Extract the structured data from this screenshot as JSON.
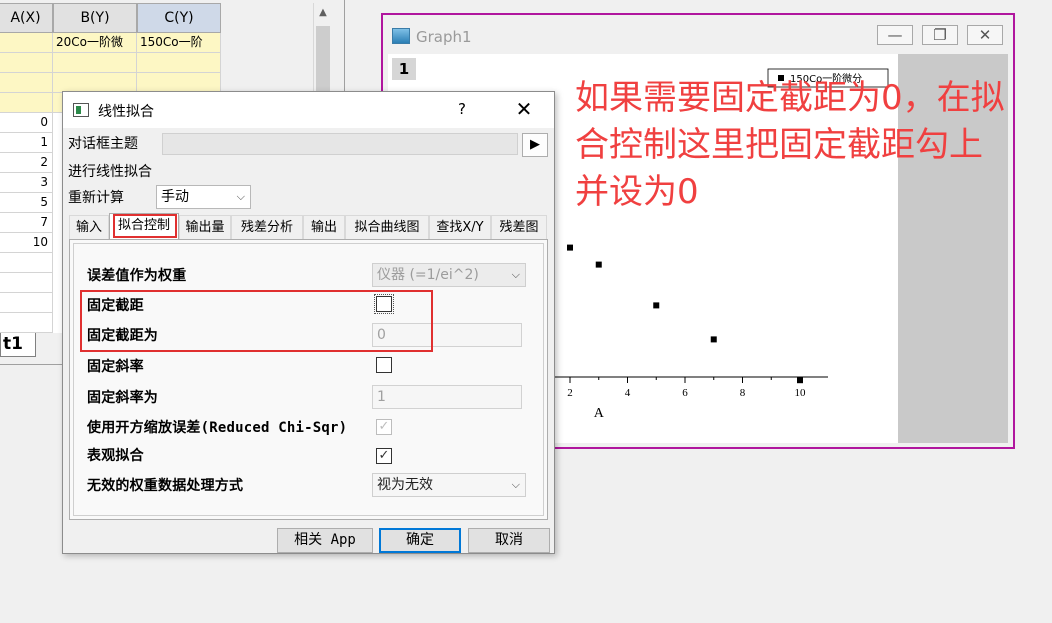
{
  "worksheet": {
    "columns": [
      "A(X)",
      "B(Y)",
      "C(Y)"
    ],
    "comments_row": [
      "",
      "20Co一阶微",
      "150Co一阶"
    ],
    "row_values": [
      "0",
      "1",
      "2",
      "3",
      "5",
      "7",
      "10"
    ],
    "sheet_tab": "t1",
    "scroll_up": "▲"
  },
  "graph": {
    "title": "Graph1",
    "layer": "1",
    "legend": "150Co一阶微分",
    "x_axis_label": "A",
    "minimize": "—",
    "restore": "❐",
    "close": "✕"
  },
  "chart_data": {
    "type": "scatter",
    "x_ticks": [
      "2",
      "4",
      "6",
      "8",
      "10"
    ],
    "xlabel": "A",
    "visible_points": [
      {
        "x": 2,
        "y": 5.6
      },
      {
        "x": 3,
        "y": 5.1
      },
      {
        "x": 5,
        "y": 3.9
      },
      {
        "x": 7,
        "y": 2.9
      },
      {
        "x": 10,
        "y": 1.7
      }
    ],
    "series": [
      {
        "name": "150Co一阶微分"
      }
    ]
  },
  "annotation": {
    "lines": [
      "如果需要固定截距为0，在拟",
      "合控制这里把固定截距勾上",
      "并设为0"
    ],
    "color": "#f04040"
  },
  "dialog": {
    "title": "线性拟合",
    "help": "?",
    "close": "✕",
    "theme_label": "对话框主题",
    "theme_arrow": "▶",
    "fit_label": "进行线性拟合",
    "recalc_label": "重新计算",
    "recalc_value": "手动",
    "tabs": [
      "输入",
      "拟合控制",
      "输出量",
      "残差分析",
      "输出",
      "拟合曲线图",
      "查找X/Y",
      "残差图"
    ],
    "active_tab": "拟合控制",
    "fields": {
      "error_weight_label": "误差值作为权重",
      "error_weight_value": "仪器 (=1/ei^2)",
      "fix_intercept_label": "固定截距",
      "fix_intercept_checked": false,
      "fix_intercept_at_label": "固定截距为",
      "fix_intercept_at_value": "0",
      "fix_slope_label": "固定斜率",
      "fix_slope_checked": false,
      "fix_slope_at_label": "固定斜率为",
      "fix_slope_at_value": "1",
      "reduced_chisqr_label": "使用开方缩放误差(Reduced Chi-Sqr)",
      "reduced_chisqr_checked": true,
      "apparent_fit_label": "表观拟合",
      "apparent_fit_checked": true,
      "invalid_weight_label": "无效的权重数据处理方式",
      "invalid_weight_value": "视为无效"
    },
    "buttons": {
      "app": "相关 App",
      "ok": "确定",
      "cancel": "取消"
    },
    "highlight_color": "#e03030"
  }
}
